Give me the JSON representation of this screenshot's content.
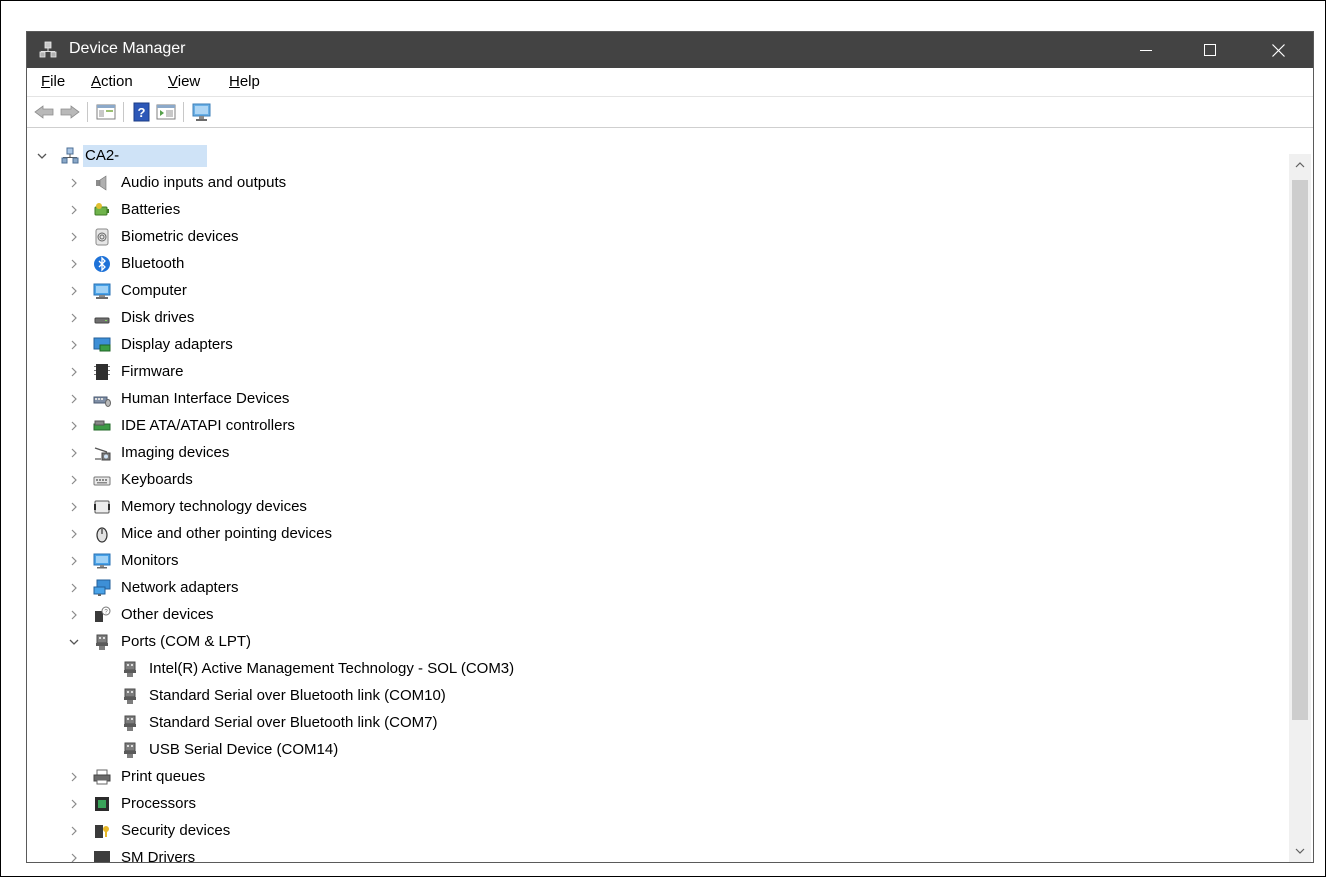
{
  "window": {
    "title": "Device Manager"
  },
  "menu": [
    {
      "label": "File",
      "accel": "F",
      "rest": "ile"
    },
    {
      "label": "Action",
      "accel": "A",
      "rest": "ction"
    },
    {
      "label": "View",
      "accel": "V",
      "rest": "iew"
    },
    {
      "label": "Help",
      "accel": "H",
      "rest": "elp"
    }
  ],
  "tree": {
    "root": "CA2-",
    "categories": [
      {
        "label": "Audio inputs and outputs",
        "icon": "speaker-icon"
      },
      {
        "label": "Batteries",
        "icon": "battery-icon"
      },
      {
        "label": "Biometric devices",
        "icon": "fingerprint-icon"
      },
      {
        "label": "Bluetooth",
        "icon": "bluetooth-icon"
      },
      {
        "label": "Computer",
        "icon": "computer-icon"
      },
      {
        "label": "Disk drives",
        "icon": "disk-drive-icon"
      },
      {
        "label": "Display adapters",
        "icon": "display-adapter-icon"
      },
      {
        "label": "Firmware",
        "icon": "firmware-icon"
      },
      {
        "label": "Human Interface Devices",
        "icon": "hid-icon"
      },
      {
        "label": "IDE ATA/ATAPI controllers",
        "icon": "ide-controller-icon"
      },
      {
        "label": "Imaging devices",
        "icon": "camera-icon"
      },
      {
        "label": "Keyboards",
        "icon": "keyboard-icon"
      },
      {
        "label": "Memory technology devices",
        "icon": "memory-card-icon"
      },
      {
        "label": "Mice and other pointing devices",
        "icon": "mouse-icon"
      },
      {
        "label": "Monitors",
        "icon": "monitor-icon"
      },
      {
        "label": "Network adapters",
        "icon": "network-adapter-icon"
      },
      {
        "label": "Other devices",
        "icon": "unknown-device-icon"
      },
      {
        "label": "Ports (COM & LPT)",
        "icon": "port-icon",
        "expanded": true,
        "children": [
          "Intel(R) Active Management Technology - SOL (COM3)",
          "Standard Serial over Bluetooth link (COM10)",
          "Standard Serial over Bluetooth link (COM7)",
          "USB Serial Device (COM14)"
        ]
      },
      {
        "label": "Print queues",
        "icon": "printer-icon"
      },
      {
        "label": "Processors",
        "icon": "processor-icon"
      },
      {
        "label": "Security devices",
        "icon": "security-device-icon"
      },
      {
        "label": "SM Drivers",
        "icon": "sm-driver-icon"
      }
    ]
  },
  "colors": {
    "titlebar": "#434343",
    "selection": "#cfe3f7"
  }
}
